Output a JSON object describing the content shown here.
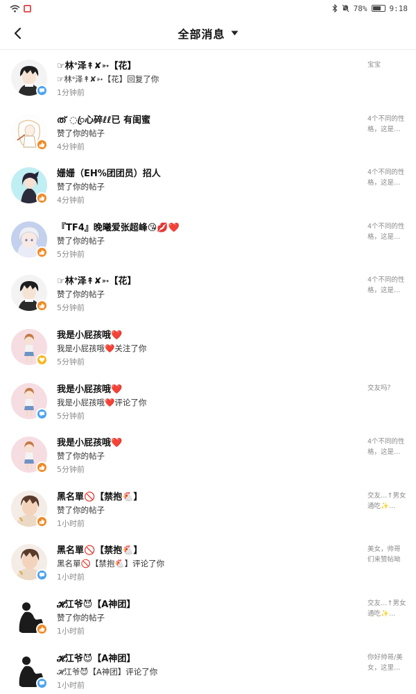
{
  "status_bar": {
    "battery_text": "78%",
    "clock": "9:18"
  },
  "header": {
    "title": "全部消息"
  },
  "messages": [
    {
      "name": "☞林ᐤ泽↟✘➳【花】",
      "action": "☞林ᐤ泽↟✘➳【花】回复了你",
      "time": "1分钟前",
      "preview": "宝宝",
      "type": "comment",
      "avatar": "avatar-boy-dark-hair"
    },
    {
      "name": "ത് ◌ꦿ心碎ℓℓ已 有闺蜜",
      "action": "赞了你的帖子",
      "time": "4分钟前",
      "preview": "4个不同的性格，这是…",
      "type": "like",
      "avatar": "avatar-girl-sketch"
    },
    {
      "name": "姗姗（EH%团团员）招人",
      "action": "赞了你的帖子",
      "time": "4分钟前",
      "preview": "4个不同的性格，这是…",
      "type": "like",
      "avatar": "avatar-girl-blue-bg"
    },
    {
      "name": "『TF4』晚曦爱张超峰😘💋❤️",
      "action": "赞了你的帖子",
      "time": "5分钟前",
      "preview": "4个不同的性格，这是…",
      "type": "like",
      "avatar": "avatar-girl-silver-hair"
    },
    {
      "name": "☞林ᐤ泽↟✘➳【花】",
      "action": "赞了你的帖子",
      "time": "5分钟前",
      "preview": "4个不同的性格，这是…",
      "type": "like",
      "avatar": "avatar-boy-dark-hair"
    },
    {
      "name": "我是小屁孩哦❤️",
      "action": "我是小屁孩哦❤️关注了你",
      "time": "5分钟前",
      "preview": "",
      "type": "follow",
      "avatar": "avatar-girl-pink-bg"
    },
    {
      "name": "我是小屁孩哦❤️",
      "action": "我是小屁孩哦❤️评论了你",
      "time": "5分钟前",
      "preview": "交友吗？",
      "type": "comment",
      "avatar": "avatar-girl-pink-bg"
    },
    {
      "name": "我是小屁孩哦❤️",
      "action": "赞了你的帖子",
      "time": "5分钟前",
      "preview": "4个不同的性格，这是…",
      "type": "like",
      "avatar": "avatar-girl-pink-bg"
    },
    {
      "name": "黑名單🚫【禁抱🐔】",
      "action": "赞了你的帖子",
      "time": "1小时前",
      "preview": "交友…↑男女通吃✨…",
      "type": "like",
      "avatar": "avatar-boy-brown-hair"
    },
    {
      "name": "黑名單🚫【禁抱🐔】",
      "action": "黑名單🚫【禁抱🐔】评论了你",
      "time": "1小时前",
      "preview": "美女，帅哥们来赞帖呦",
      "type": "comment",
      "avatar": "avatar-boy-brown-hair"
    },
    {
      "name": "𝓗江爷😈【A神团】",
      "action": "赞了你的帖子",
      "time": "1小时前",
      "preview": "交友…↑男女通吃✨…",
      "type": "like",
      "avatar": "avatar-silhouette"
    },
    {
      "name": "𝓗江爷😈【A神团】",
      "action": "𝓗江爷😈【A神团】评论了你",
      "time": "1小时前",
      "preview": "你好帅哥/美女，这里…",
      "type": "comment",
      "avatar": "avatar-silhouette"
    }
  ]
}
